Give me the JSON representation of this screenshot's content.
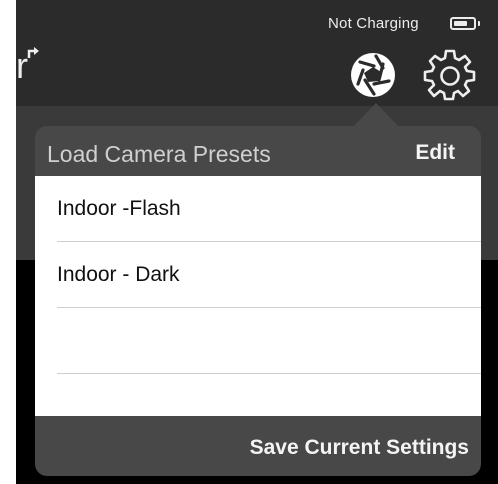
{
  "status_bar": {
    "charging_text": "Not Charging",
    "battery_icon": "battery-icon"
  },
  "nav_bar": {
    "title_fragment": "r",
    "aperture_icon": "aperture-icon",
    "gear_icon": "gear-icon"
  },
  "popover": {
    "title": "Load Camera Presets",
    "edit_label": "Edit",
    "presets": [
      {
        "label": "Indoor -Flash"
      },
      {
        "label": "Indoor - Dark"
      },
      {
        "label": ""
      },
      {
        "label": ""
      }
    ],
    "save_label": "Save Current Settings"
  },
  "colors": {
    "bar_background": "#2b2b2b",
    "popover_background": "#484848",
    "text_light": "#f4f4f4"
  }
}
